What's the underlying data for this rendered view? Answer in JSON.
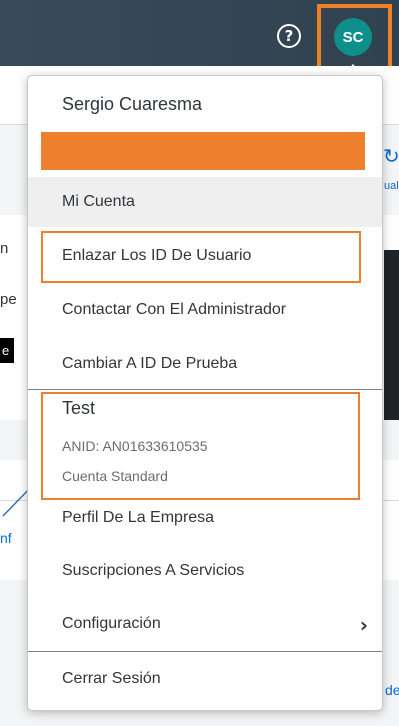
{
  "header": {
    "help_symbol": "?",
    "avatar_initials": "SC"
  },
  "background": {
    "frag_n": "n",
    "frag_pe": "pe",
    "frag_e": "e",
    "frag_nf": "nf",
    "frag_de": "de",
    "frag_ual": "ual"
  },
  "menu": {
    "user_name": "Sergio Cuaresma",
    "items": [
      {
        "label": "Mi Cuenta"
      },
      {
        "label": "Enlazar Los ID De Usuario"
      },
      {
        "label": "Contactar Con El Administrador"
      },
      {
        "label": "Cambiar A ID De Prueba"
      }
    ],
    "account": {
      "title": "Test",
      "anid": "ANID: AN01633610535",
      "plan": "Cuenta Standard"
    },
    "items2": [
      {
        "label": "Perfil De La Empresa"
      },
      {
        "label": "Suscripciones A Servicios"
      },
      {
        "label": "Configuración"
      }
    ],
    "logout": "Cerrar Sesión"
  },
  "colors": {
    "highlight": "#ee7f2d",
    "avatar_bg": "#0f8f8c",
    "header_bg": "#3a4a5c"
  }
}
